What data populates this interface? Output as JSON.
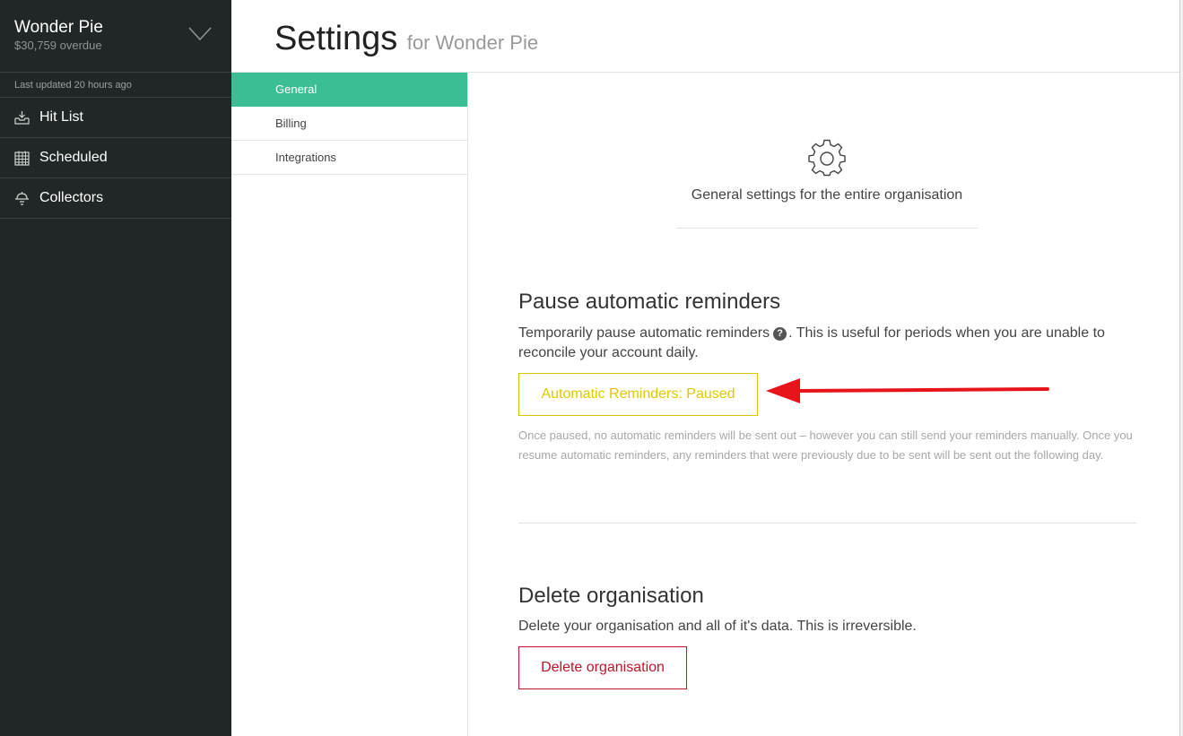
{
  "sidebar": {
    "org_name": "Wonder Pie",
    "org_overdue": "$30,759 overdue",
    "last_updated": "Last updated 20 hours ago",
    "nav": [
      {
        "label": "Hit List",
        "icon": "inbox-icon"
      },
      {
        "label": "Scheduled",
        "icon": "calendar-icon"
      },
      {
        "label": "Collectors",
        "icon": "bell-icon"
      }
    ]
  },
  "header": {
    "title": "Settings",
    "subtitle": "for Wonder Pie"
  },
  "tabs": [
    {
      "label": "General",
      "active": true
    },
    {
      "label": "Billing",
      "active": false
    },
    {
      "label": "Integrations",
      "active": false
    }
  ],
  "general": {
    "icon": "gear-icon",
    "caption": "General settings for the entire organisation"
  },
  "pause_section": {
    "heading": "Pause automatic reminders",
    "desc_before": "Temporarily pause automatic reminders",
    "help_glyph": "?",
    "desc_after": ". This is useful for periods when you are unable to reconcile your account daily.",
    "button_label": "Automatic Reminders: Paused",
    "note": "Once paused, no automatic reminders will be sent out – however you can still send your reminders manually. Once you resume automatic reminders, any reminders that were previously due to be sent will be sent out the following day."
  },
  "delete_section": {
    "heading": "Delete organisation",
    "desc": "Delete your organisation and all of it's data. This is irreversible.",
    "button_label": "Delete organisation"
  },
  "colors": {
    "sidebar_bg": "#212726",
    "accent": "#3bbd96",
    "paused": "#e0c800",
    "danger": "#c0142a",
    "annotation_arrow": "#e8141c"
  }
}
